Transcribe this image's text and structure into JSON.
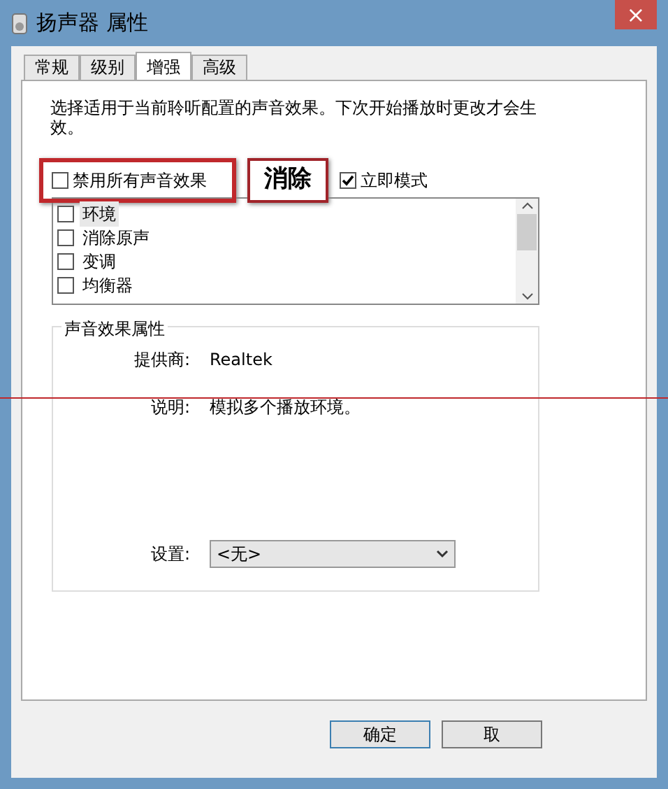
{
  "window": {
    "title": "扬声器 属性",
    "close": "×"
  },
  "tabs": [
    {
      "label": "常规",
      "selected": false
    },
    {
      "label": "级别",
      "selected": false
    },
    {
      "label": "增强",
      "selected": true
    },
    {
      "label": "高级",
      "selected": false
    }
  ],
  "description": "选择适用于当前聆听配置的声音效果。下次开始播放时更改才会生效。",
  "disable_all": {
    "label": "禁用所有声音效果",
    "checked": false
  },
  "annotation": "消除",
  "immediate_mode": {
    "label": "立即模式",
    "checked": true
  },
  "effects": [
    {
      "label": "环境",
      "checked": false,
      "selected": true
    },
    {
      "label": "消除原声",
      "checked": false,
      "selected": false
    },
    {
      "label": "变调",
      "checked": false,
      "selected": false
    },
    {
      "label": "均衡器",
      "checked": false,
      "selected": false
    }
  ],
  "properties": {
    "title": "声音效果属性",
    "provider_label": "提供商:",
    "provider": "Realtek",
    "description_label": "说明:",
    "description": "模拟多个播放环境。",
    "settings_label": "设置:",
    "settings_value": "<无>"
  },
  "buttons": [
    "确定",
    "取"
  ]
}
